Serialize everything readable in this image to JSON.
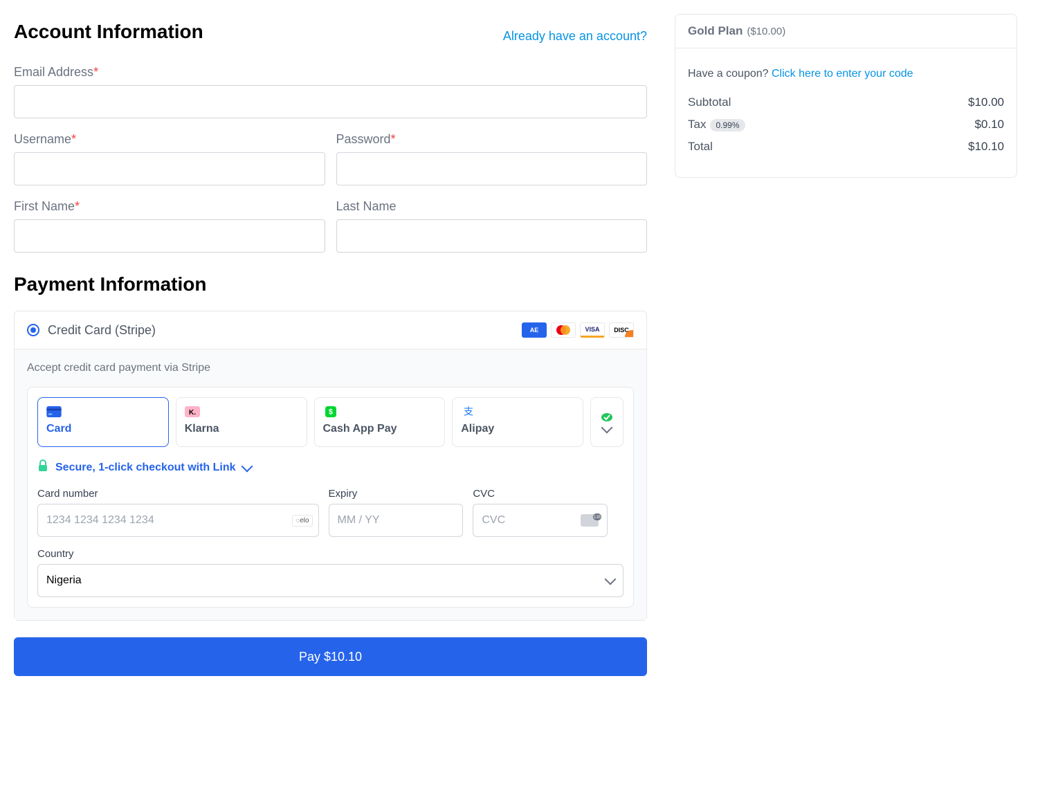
{
  "account": {
    "heading": "Account Information",
    "login_link": "Already have an account?",
    "email_label": "Email Address",
    "username_label": "Username",
    "password_label": "Password",
    "firstname_label": "First Name",
    "lastname_label": "Last Name"
  },
  "payment": {
    "heading": "Payment Information",
    "method_label": "Credit Card (Stripe)",
    "body_desc": "Accept credit card payment via Stripe",
    "secure_link": "Secure, 1-click checkout with Link",
    "card_number_label": "Card number",
    "card_number_placeholder": "1234 1234 1234 1234",
    "expiry_label": "Expiry",
    "expiry_placeholder": "MM / YY",
    "cvc_label": "CVC",
    "cvc_placeholder": "CVC",
    "country_label": "Country",
    "country_value": "Nigeria",
    "tabs": [
      "Card",
      "Klarna",
      "Cash App Pay",
      "Alipay"
    ],
    "brands": [
      "AMEX",
      "MC",
      "VISA",
      "DISCOVER"
    ],
    "card_badge": "elo"
  },
  "pay_button": "Pay $10.10",
  "summary": {
    "plan_name": "Gold Plan",
    "plan_price": "($10.00)",
    "coupon_q": "Have a coupon? ",
    "coupon_link": "Click here to enter your code",
    "subtotal_label": "Subtotal",
    "subtotal_value": "$10.00",
    "tax_label": "Tax",
    "tax_rate": "0.99%",
    "tax_value": "$0.10",
    "total_label": "Total",
    "total_value": "$10.10"
  }
}
